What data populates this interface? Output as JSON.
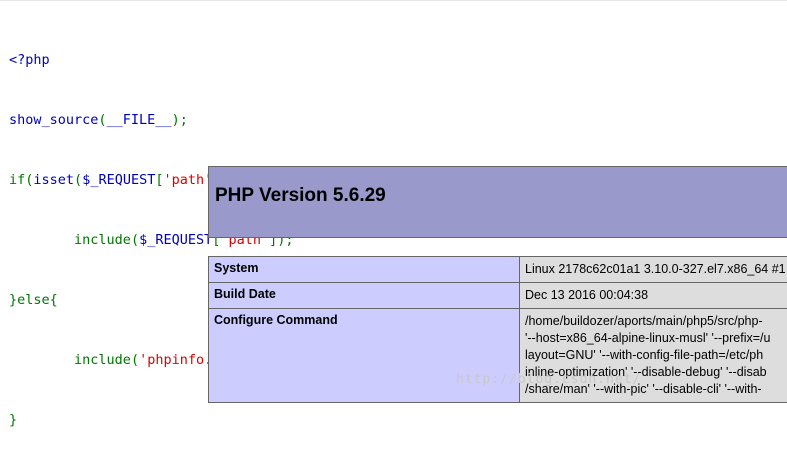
{
  "source_code": {
    "line1": {
      "open_tag": "<?php"
    },
    "line2": {
      "fn": "show_source",
      "open": "(",
      "const": "__FILE__",
      "close": ");"
    },
    "line3": {
      "kw_if": "if",
      "open1": "(",
      "kw_isset": "isset",
      "open2": "(",
      "var": "$_REQUEST",
      "br_open": "[",
      "key": "'path'",
      "br_close": "]",
      "close": ")){"
    },
    "line4": {
      "indent": "        ",
      "kw_include": "include",
      "open": "(",
      "var": "$_REQUEST",
      "br_open": "[",
      "key": "'path'",
      "br_close": "]",
      "close": ");"
    },
    "line5": {
      "brace_else": "}else{"
    },
    "line6": {
      "indent": "        ",
      "kw_include": "include",
      "open": "(",
      "file": "'phpinfo.php'",
      "close": ");"
    },
    "line7": {
      "brace": "}"
    }
  },
  "phpinfo": {
    "title": "PHP Version 5.6.29",
    "rows": [
      {
        "label": "System",
        "value_lines": [
          "Linux 2178c62c01a1 3.10.0-327.el7.x86_64 #1"
        ]
      },
      {
        "label": "Build Date",
        "value_lines": [
          "Dec 13 2016 00:04:38"
        ]
      },
      {
        "label": "Configure Command",
        "value_lines": [
          "/home/buildozer/aports/main/php5/src/php-",
          "'--host=x86_64-alpine-linux-musl' '--prefix=/u",
          "layout=GNU' '--with-config-file-path=/etc/ph",
          "inline-optimization' '--disable-debug' '--disab",
          "/share/man' '--with-pic' '--disable-cli' '--with-"
        ]
      }
    ]
  },
  "watermark": "http://blog.csdn.net/",
  "colors": {
    "header_bg": "#9999cc",
    "label_bg": "#ccccff",
    "value_bg": "#dddddd",
    "keyword": "#0000bb",
    "punct": "#007700",
    "string": "#dd0000"
  }
}
